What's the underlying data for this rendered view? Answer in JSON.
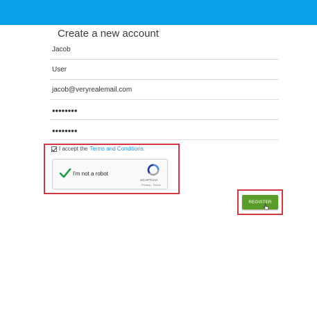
{
  "page": {
    "title": "Create a new account"
  },
  "form": {
    "first_name": "Jacob",
    "last_name": "User",
    "email": "jacob@veryrealemail.com",
    "password": "••••••••",
    "confirm_password": "••••••••"
  },
  "terms": {
    "checked": true,
    "prefix": "I accept the",
    "link": "Terms and Conditions."
  },
  "captcha": {
    "checked": true,
    "label": "I'm not a robot",
    "brand": "reCAPTCHA",
    "links": "Privacy - Terms"
  },
  "actions": {
    "register_label": "REGISTER"
  },
  "colors": {
    "header": "#0aa0e8",
    "highlight": "#d3363f",
    "register": "#5a9c2a",
    "link": "#1d8fd8"
  }
}
